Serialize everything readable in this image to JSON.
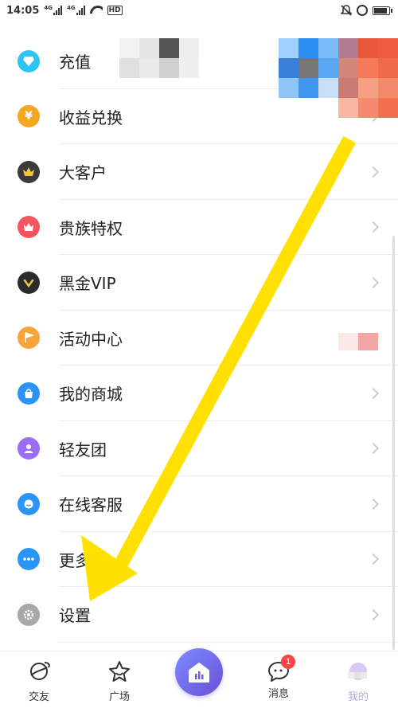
{
  "status_bar": {
    "time": "14:05",
    "signal_1_label": "4G",
    "signal_2_label": "4G",
    "hd_label": "HD"
  },
  "menu": {
    "items": [
      {
        "label": "充值",
        "icon": "diamond-icon",
        "color": "#2ec4f5"
      },
      {
        "label": "收益兑换",
        "icon": "yen-coin-icon",
        "color": "#f5a623"
      },
      {
        "label": "大客户",
        "icon": "crown-icon",
        "color": "#3a3a3a"
      },
      {
        "label": "贵族特权",
        "icon": "crown-badge-icon",
        "color": "#f5565d"
      },
      {
        "label": "黑金VIP",
        "icon": "vip-check-icon",
        "color": "#2b2b2b"
      },
      {
        "label": "活动中心",
        "icon": "flag-icon",
        "color": "#f6a53a"
      },
      {
        "label": "我的商城",
        "icon": "shopping-bag-icon",
        "color": "#2b95f6"
      },
      {
        "label": "轻友团",
        "icon": "user-icon",
        "color": "#9b6cf5"
      },
      {
        "label": "在线客服",
        "icon": "customer-service-icon",
        "color": "#2b95f6"
      },
      {
        "label": "更多",
        "icon": "more-dots-icon",
        "color": "#2b95f6"
      },
      {
        "label": "设置",
        "icon": "gear-icon",
        "color": "#a8a8a8"
      }
    ]
  },
  "bottom_nav": {
    "items": [
      {
        "label": "交友",
        "icon": "planet-icon"
      },
      {
        "label": "广场",
        "icon": "star-icon"
      },
      {
        "label": "",
        "icon": "home-chart-icon"
      },
      {
        "label": "消息",
        "icon": "chat-bubble-icon",
        "badge": "1"
      },
      {
        "label": "我的",
        "icon": "profile-icon"
      }
    ]
  },
  "colors": {
    "accent": "#6a5cf0",
    "arrow": "#ffe000",
    "badge": "#f44444"
  }
}
